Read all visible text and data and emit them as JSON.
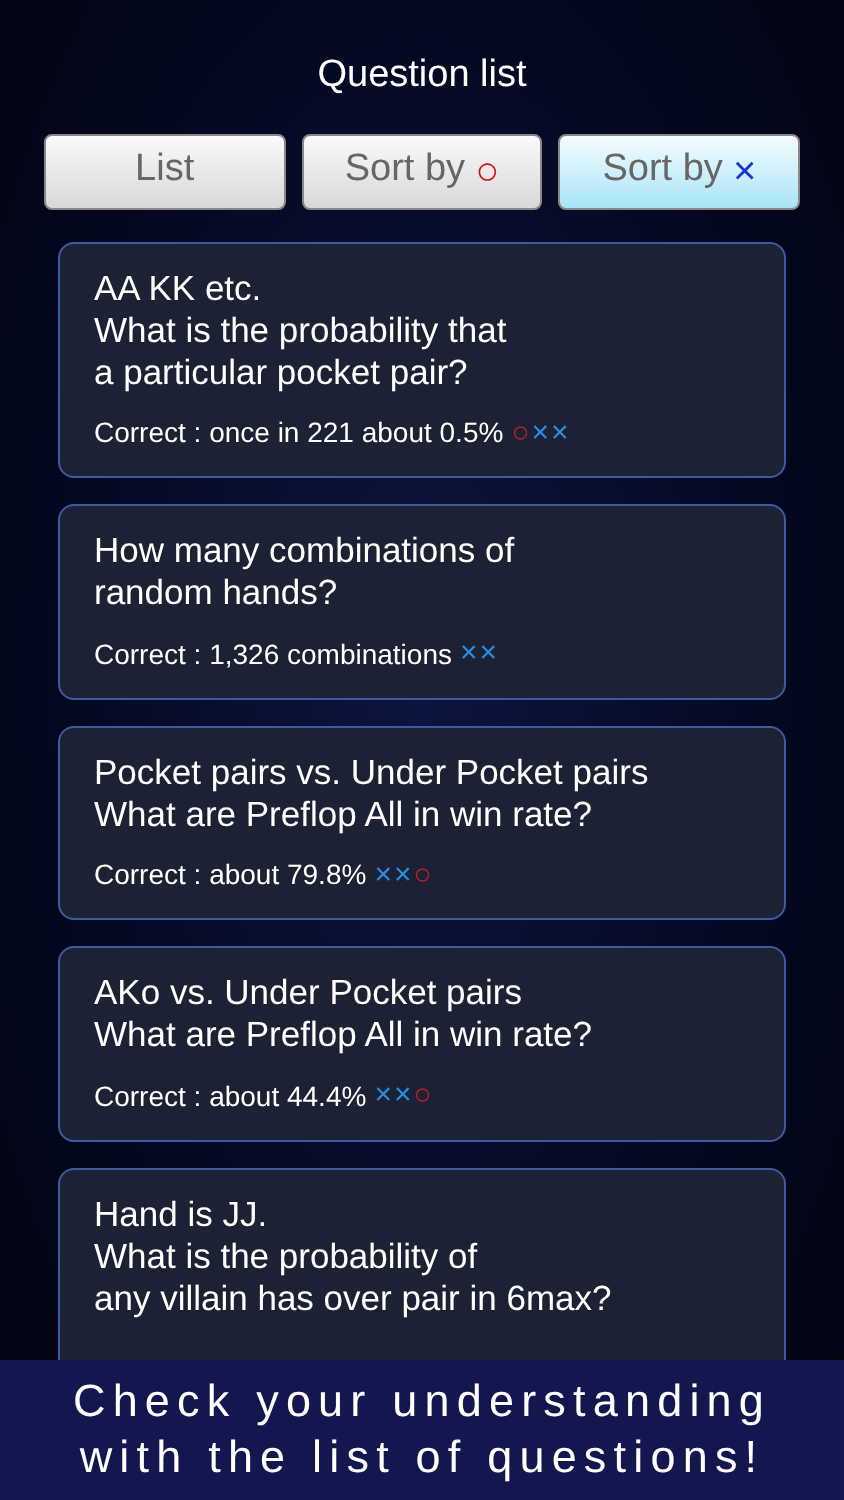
{
  "title": "Question list",
  "tabs": [
    {
      "label": "List",
      "selected": false
    },
    {
      "label": "Sort by",
      "mark": {
        "kind": "correct",
        "symbol": "○"
      },
      "selected": false
    },
    {
      "label": "Sort by",
      "mark": {
        "kind": "wrong",
        "symbol": "×"
      },
      "selected": true
    }
  ],
  "questions": [
    {
      "lines": [
        "AA KK etc.",
        "What is the probability that",
        "a particular pocket pair?"
      ],
      "answer": "Correct : once in 221 about 0.5%",
      "results": [
        {
          "kind": "correct",
          "symbol": "○"
        },
        {
          "kind": "wrong",
          "symbol": "×"
        },
        {
          "kind": "wrong",
          "symbol": "×"
        }
      ]
    },
    {
      "lines": [
        "How many combinations of",
        "random hands?"
      ],
      "answer": "Correct : 1,326 combinations",
      "results": [
        {
          "kind": "wrong",
          "symbol": "×"
        },
        {
          "kind": "wrong",
          "symbol": "×"
        }
      ]
    },
    {
      "lines": [
        "Pocket pairs vs. Under Pocket pairs",
        "What are Preflop All in win rate?"
      ],
      "answer": "Correct : about 79.8%",
      "results": [
        {
          "kind": "wrong",
          "symbol": "×"
        },
        {
          "kind": "wrong",
          "symbol": "×"
        },
        {
          "kind": "correct",
          "symbol": "○"
        }
      ]
    },
    {
      "lines": [
        "AKo vs. Under Pocket pairs",
        "What are Preflop All in win rate?"
      ],
      "answer": "Correct : about 44.4%",
      "results": [
        {
          "kind": "wrong",
          "symbol": "×"
        },
        {
          "kind": "wrong",
          "symbol": "×"
        },
        {
          "kind": "correct",
          "symbol": "○"
        }
      ]
    },
    {
      "lines": [
        "Hand is JJ.",
        "What is the probability of",
        "any villain has over pair in 6max?"
      ]
    }
  ],
  "banner": [
    "Check your understanding",
    "with the list of questions!"
  ]
}
